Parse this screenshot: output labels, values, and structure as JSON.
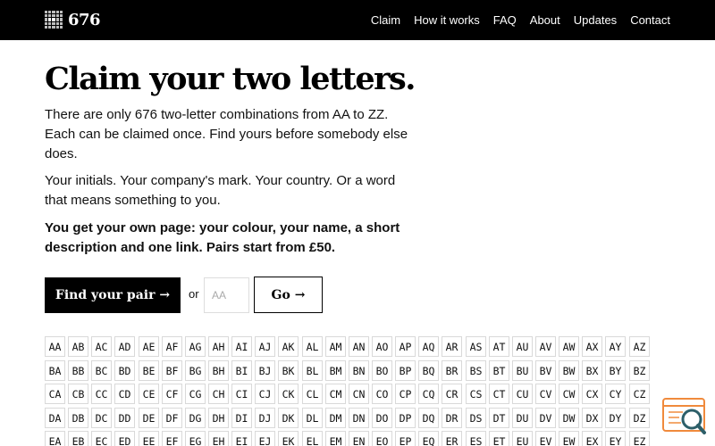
{
  "header": {
    "logo_text": "676",
    "nav": [
      "Claim",
      "How it works",
      "FAQ",
      "About",
      "Updates",
      "Contact"
    ]
  },
  "hero": {
    "title": "Claim your two letters.",
    "paragraph1": "There are only 676 two-letter combinations from AA to ZZ. Each can be claimed once. Find yours before somebody else does.",
    "paragraph2": "Your initials. Your company's mark. Your country. Or a word that means something to you.",
    "paragraph3": "You get your own page: your colour, your name, a short description and one link. Pairs start from £50."
  },
  "actions": {
    "find_label": "Find your pair →",
    "or_label": "or",
    "input_placeholder": "AA",
    "input_value": "",
    "go_label": "Go →"
  },
  "pairs": {
    "letters": "ABCDEFGHIJKLMNOPQRSTUVWXYZ",
    "visible_rows": [
      "A",
      "B",
      "C",
      "D",
      "E"
    ]
  },
  "colors": {
    "header_bg": "#000000",
    "header_text": "#ffffff",
    "cell_border": "#d9d9d9",
    "badge_orange": "#f08a3c",
    "badge_teal": "#2d5f69"
  },
  "icons": {
    "logo": "letter-grid-icon",
    "badge": "search-magnifier-icon"
  }
}
